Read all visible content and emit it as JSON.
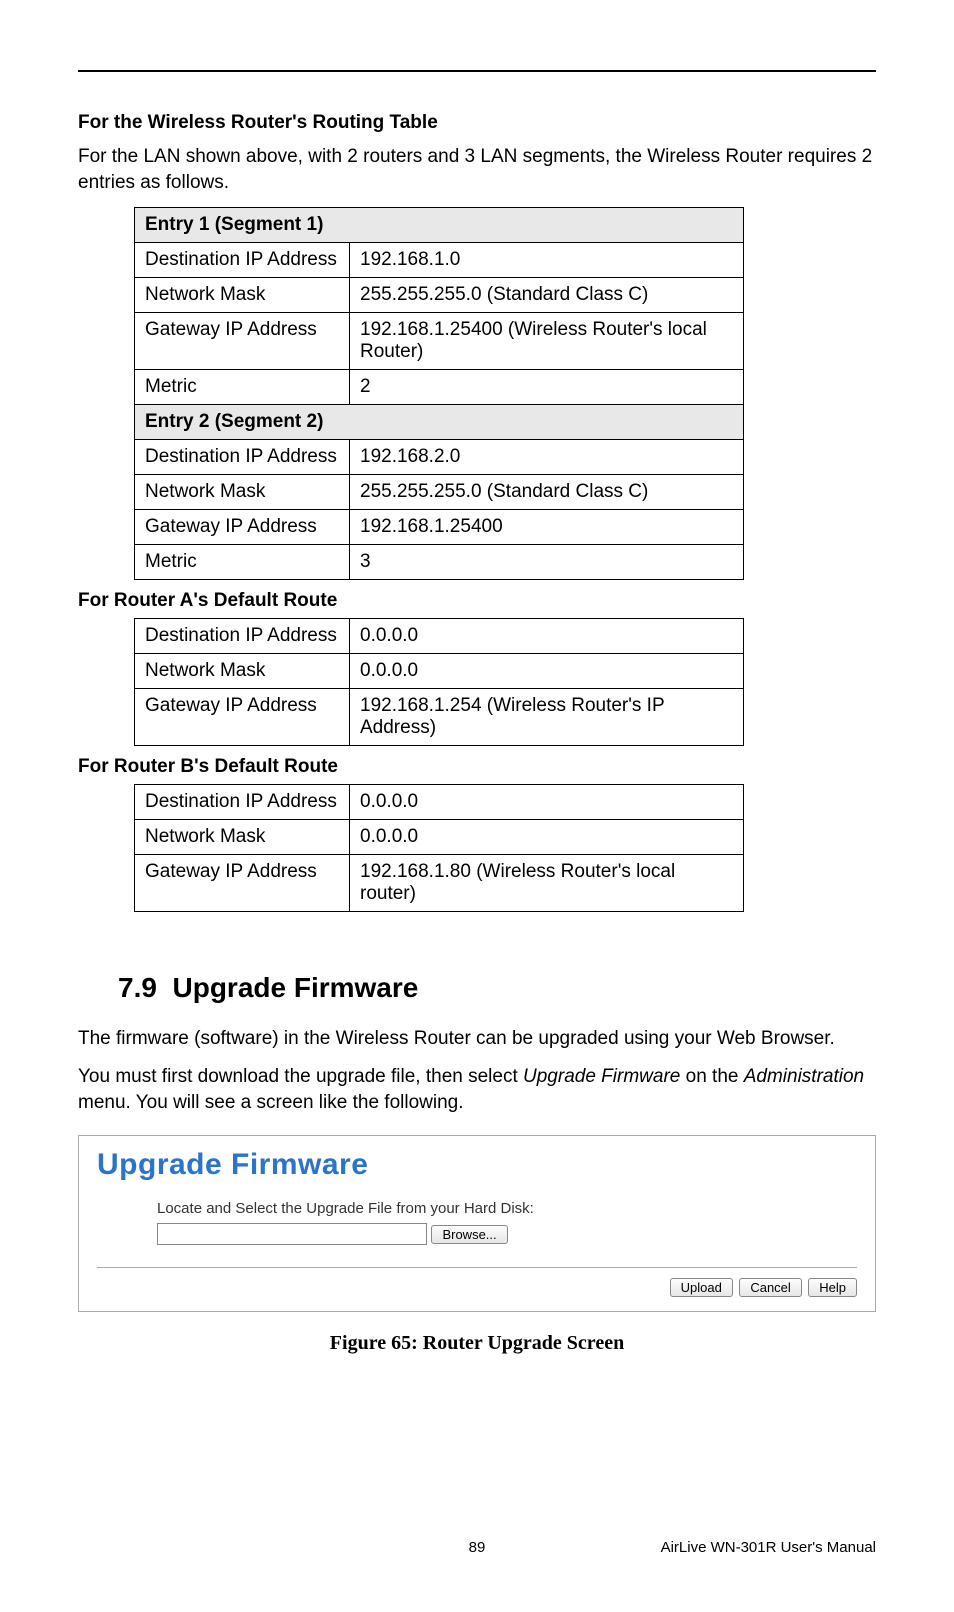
{
  "headings": {
    "routing_table": "For the Wireless Router's Routing Table",
    "routing_intro": "For the LAN shown above, with 2 routers and 3 LAN segments, the Wireless Router requires 2 entries as follows.",
    "router_a": "For Router A's Default Route",
    "router_b": "For Router B's Default Route",
    "section_number": "7.9",
    "section_title": "Upgrade Firmware",
    "upgrade_para1": "The firmware (software) in the Wireless Router can be upgraded using your Web Browser.",
    "upgrade_para2_a": "You must first download the upgrade file, then select ",
    "upgrade_para2_italic1": "Upgrade Firmware",
    "upgrade_para2_b": " on the ",
    "upgrade_para2_italic2": "Administration",
    "upgrade_para2_c": " menu. You will see a screen like the following.",
    "figure_caption": "Figure 65: Router Upgrade Screen"
  },
  "table1": {
    "entry1_header": "Entry 1 (Segment 1)",
    "rows1": [
      {
        "label": "Destination IP Address",
        "value": "192.168.1.0"
      },
      {
        "label": "Network Mask",
        "value": "255.255.255.0  (Standard Class C)"
      },
      {
        "label": "Gateway IP Address",
        "value": "192.168.1.25400  (Wireless Router's local Router)"
      },
      {
        "label": "Metric",
        "value": "2"
      }
    ],
    "entry2_header": "Entry 2 (Segment 2)",
    "rows2": [
      {
        "label": "Destination IP Address",
        "value": "192.168.2.0"
      },
      {
        "label": "Network Mask",
        "value": "255.255.255.0  (Standard Class C)"
      },
      {
        "label": "Gateway IP Address",
        "value": "192.168.1.25400"
      },
      {
        "label": "Metric",
        "value": "3"
      }
    ]
  },
  "table_a": [
    {
      "label": "Destination IP Address",
      "value": "0.0.0.0"
    },
    {
      "label": "Network Mask",
      "value": "0.0.0.0"
    },
    {
      "label": "Gateway IP Address",
      "value": "192.168.1.254  (Wireless Router's IP Address)"
    }
  ],
  "table_b": [
    {
      "label": "Destination IP Address",
      "value": "0.0.0.0"
    },
    {
      "label": "Network Mask",
      "value": "0.0.0.0"
    },
    {
      "label": "Gateway IP Address",
      "value": "192.168.1.80 (Wireless Router's local router)"
    }
  ],
  "panel": {
    "title": "Upgrade Firmware",
    "locate_text": "Locate and Select the Upgrade File from your Hard Disk:",
    "browse": "Browse...",
    "upload": "Upload",
    "cancel": "Cancel",
    "help": "Help"
  },
  "footer": {
    "page": "89",
    "right": "AirLive WN-301R User's Manual"
  }
}
